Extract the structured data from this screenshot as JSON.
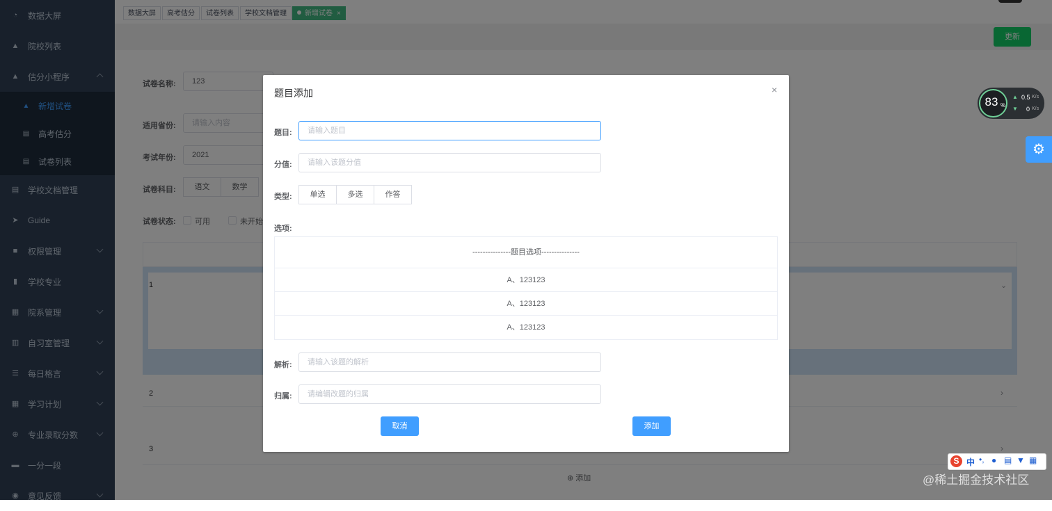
{
  "sidebar": {
    "items": [
      {
        "label": "数据大屏",
        "icon": "dashboard-icon"
      },
      {
        "label": "院校列表",
        "icon": "school-icon"
      },
      {
        "label": "估分小程序",
        "icon": "school-icon",
        "expanded": true
      },
      {
        "label": "学校文档管理",
        "icon": "document-icon"
      },
      {
        "label": "Guide",
        "icon": "send-icon"
      },
      {
        "label": "权限管理",
        "icon": "lock-icon"
      },
      {
        "label": "学校专业",
        "icon": "book-icon"
      },
      {
        "label": "院系管理",
        "icon": "grid-icon"
      },
      {
        "label": "自习室管理",
        "icon": "chart-icon"
      },
      {
        "label": "每日格言",
        "icon": "list-icon"
      },
      {
        "label": "学习计划",
        "icon": "table-icon"
      },
      {
        "label": "专业录取分数",
        "icon": "plus-circle-icon"
      },
      {
        "label": "一分一段",
        "icon": "folder-icon"
      },
      {
        "label": "意见反馈",
        "icon": "feedback-icon"
      }
    ],
    "sub_items": [
      {
        "label": "新增试卷",
        "active": true
      },
      {
        "label": "高考估分"
      },
      {
        "label": "试卷列表"
      }
    ]
  },
  "tags": [
    "数据大屏",
    "高考估分",
    "试卷列表",
    "学校文档管理",
    "新增试卷"
  ],
  "toolbar": {
    "refresh_label": "更新"
  },
  "form": {
    "name_label": "试卷名称:",
    "name_value": "123",
    "province_label": "适用省份:",
    "province_placeholder": "请输入内容",
    "year_label": "考试年份:",
    "year_value": "2021",
    "subject_label": "试卷科目:",
    "subjects": [
      "语文",
      "数学"
    ],
    "status_label": "试卷状态:",
    "status_options": [
      "可用",
      "未开始"
    ]
  },
  "list": {
    "rows": [
      "1",
      "2",
      "3"
    ],
    "add_label": "添加"
  },
  "dialog": {
    "title": "题目添加",
    "question_label": "题目:",
    "question_placeholder": "请输入题目",
    "score_label": "分值:",
    "score_placeholder": "请输入该题分值",
    "type_label": "类型:",
    "types": [
      "单选",
      "多选",
      "作答"
    ],
    "options_label": "选项:",
    "options_header": "---------------题目选项---------------",
    "options": [
      "A、123123",
      "A、123123",
      "A、123123"
    ],
    "analysis_label": "解析:",
    "analysis_placeholder": "请输入该题的解析",
    "belong_label": "归属:",
    "belong_placeholder": "请编辑改题的归属",
    "cancel_label": "取消",
    "add_label": "添加"
  },
  "widget": {
    "percent": "83",
    "percent_unit": "%",
    "up_speed": "0.5",
    "down_speed": "0",
    "speed_unit": "K/s"
  },
  "ime": {
    "label": "中"
  },
  "watermark": "@稀土掘金技术社区"
}
